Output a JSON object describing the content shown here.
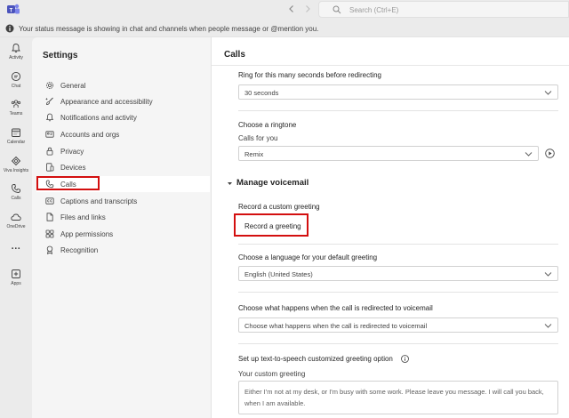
{
  "titlebar": {
    "search_placeholder": "Search (Ctrl+E)",
    "logo_icon": "teams-logo-icon",
    "back_icon": "chevron-left-icon",
    "forward_icon": "chevron-right-icon"
  },
  "banner": {
    "text": "Your status message is showing in chat and channels when people message or @mention you."
  },
  "rail": {
    "items": [
      {
        "label": "Activity",
        "icon": "bell-icon"
      },
      {
        "label": "Chat",
        "icon": "chat-icon"
      },
      {
        "label": "Teams",
        "icon": "teams-icon"
      },
      {
        "label": "Calendar",
        "icon": "calendar-icon"
      },
      {
        "label": "Viva Insights",
        "icon": "insights-icon"
      },
      {
        "label": "Calls",
        "icon": "phone-icon"
      },
      {
        "label": "OneDrive",
        "icon": "cloud-icon"
      },
      {
        "label": "...",
        "icon": "more-icon"
      },
      {
        "label": "Apps",
        "icon": "add-app-icon"
      }
    ]
  },
  "settings": {
    "title": "Settings",
    "items": [
      {
        "label": "General",
        "icon": "gear-icon"
      },
      {
        "label": "Appearance and accessibility",
        "icon": "paint-brush-icon"
      },
      {
        "label": "Notifications and activity",
        "icon": "bell-icon"
      },
      {
        "label": "Accounts and orgs",
        "icon": "id-card-icon"
      },
      {
        "label": "Privacy",
        "icon": "lock-icon"
      },
      {
        "label": "Devices",
        "icon": "devices-icon"
      },
      {
        "label": "Calls",
        "icon": "phone-icon"
      },
      {
        "label": "Captions and transcripts",
        "icon": "captions-icon"
      },
      {
        "label": "Files and links",
        "icon": "file-icon"
      },
      {
        "label": "App permissions",
        "icon": "app-grid-icon"
      },
      {
        "label": "Recognition",
        "icon": "recognition-icon"
      }
    ],
    "selected": "Calls"
  },
  "main": {
    "title": "Calls",
    "ring": {
      "label": "Ring for this many seconds before redirecting",
      "value": "30 seconds"
    },
    "ringtone": {
      "label": "Choose a ringtone",
      "sublabel": "Calls for you",
      "value": "Remix"
    },
    "voicemail": {
      "section_title": "Manage voicemail",
      "record_label": "Record a custom greeting",
      "record_button": "Record a greeting",
      "language_label": "Choose a language for your default greeting",
      "language_value": "English (United States)",
      "redirect_label": "Choose what happens when the call is redirected to voicemail",
      "redirect_value": "Choose what happens when the call is redirected to voicemail",
      "tts_label": "Set up text-to-speech customized greeting option",
      "custom_greeting_label": "Your custom greeting",
      "custom_greeting_text": "Either I'm not at my desk, or I'm busy with some work. Please leave you message. I will call you back, when I am available."
    }
  },
  "colors": {
    "accent": "#5b5fc7",
    "highlight_border": "#d30f0f",
    "background": "#ebebeb"
  }
}
